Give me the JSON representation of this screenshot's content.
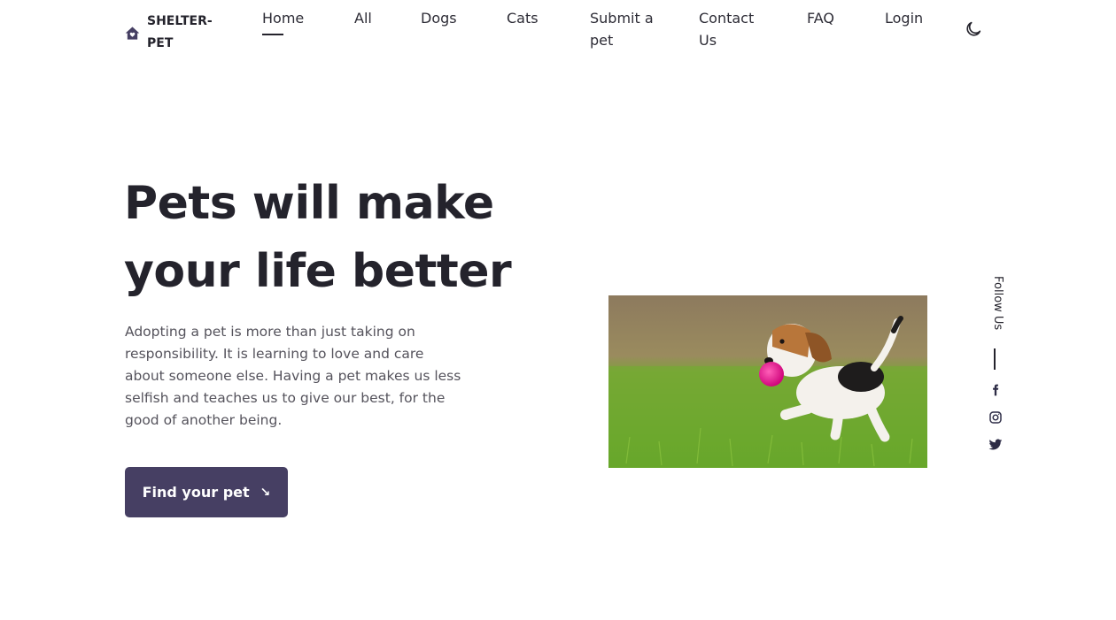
{
  "brand": {
    "name": "SHELTER-PET",
    "icon": "house-heart-icon"
  },
  "nav": {
    "items": [
      {
        "label": "Home",
        "active": true
      },
      {
        "label": "All"
      },
      {
        "label": "Dogs"
      },
      {
        "label": "Cats"
      },
      {
        "label": "Submit a pet"
      },
      {
        "label": "Contact Us"
      },
      {
        "label": "FAQ"
      },
      {
        "label": "Login"
      }
    ],
    "theme_icon": "moon-icon"
  },
  "hero": {
    "title": "Pets will make your life better",
    "description": "Adopting a pet is more than just taking on responsibility. It is learning to love and care about someone else. Having a pet makes us less selfish and teaches us to give our best, for the good of another being.",
    "cta_label": "Find your pet",
    "cta_icon": "arrow-down-right-icon",
    "image": "beagle-puppy-with-pink-ball-on-grass"
  },
  "social": {
    "label": "Follow Us",
    "links": [
      "facebook-icon",
      "instagram-icon",
      "twitter-icon"
    ]
  },
  "colors": {
    "primary": "#463f63",
    "text": "#24232c",
    "muted": "#55535c",
    "background": "#ffffff"
  }
}
